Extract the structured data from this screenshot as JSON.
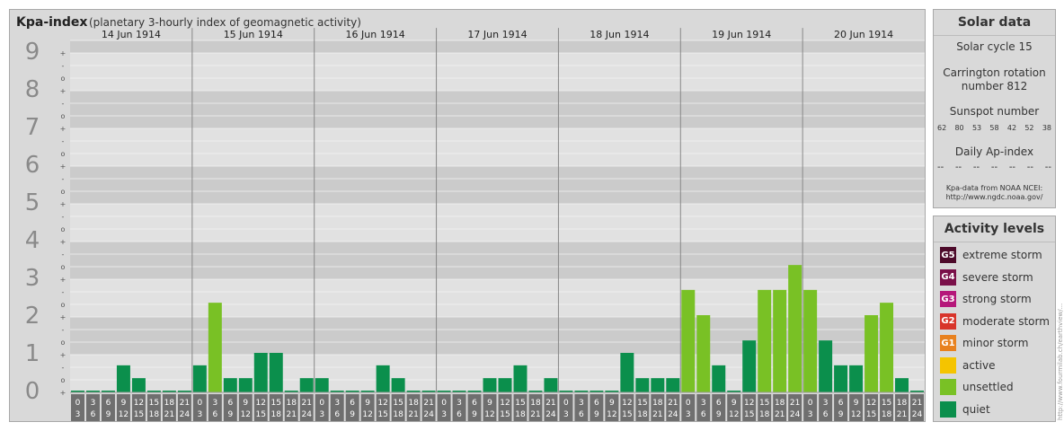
{
  "header": {
    "title": "Kpa-index",
    "subtitle": "(planetary 3-hourly index of geomagnetic activity)"
  },
  "solar_panel": {
    "title": "Solar data",
    "solar_cycle": "Solar cycle 15",
    "carrington_line1": "Carrington rotation",
    "carrington_line2": "number 812",
    "sunspot_title": "Sunspot number",
    "sunspots": [
      "62",
      "80",
      "53",
      "58",
      "42",
      "52",
      "38"
    ],
    "ap_title": "Daily Ap-index",
    "ap_values": [
      "--",
      "--",
      "--",
      "--",
      "--",
      "--",
      "--"
    ],
    "source_line1": "Kpa-data from NOAA NCEI:",
    "source_line2": "http://www.ngdc.noaa.gov/"
  },
  "activity_panel": {
    "title": "Activity levels",
    "levels": [
      {
        "badge": "G5",
        "label": "extreme storm",
        "color": "#4d0a2a"
      },
      {
        "badge": "G4",
        "label": "severe storm",
        "color": "#7a1049"
      },
      {
        "badge": "G3",
        "label": "strong storm",
        "color": "#b5177a"
      },
      {
        "badge": "G2",
        "label": "moderate storm",
        "color": "#d8342a"
      },
      {
        "badge": "G1",
        "label": "minor storm",
        "color": "#e8811e"
      },
      {
        "badge": "",
        "label": "active",
        "color": "#f5c400"
      },
      {
        "badge": "",
        "label": "unsettled",
        "color": "#79c125"
      },
      {
        "badge": "",
        "label": "quiet",
        "color": "#0b8f4c"
      }
    ]
  },
  "watermark": "http://www.fourmilab.ch/earthview/...",
  "chart_data": {
    "type": "bar",
    "title": "Kpa-index",
    "y_axis": {
      "ticks": [
        "0",
        "1",
        "2",
        "3",
        "4",
        "5",
        "6",
        "7",
        "8",
        "9"
      ],
      "min": 0,
      "max": 9.33,
      "thirds_labels": [
        "+",
        "o",
        "-"
      ]
    },
    "days": [
      "14 Jun 1914",
      "15 Jun 1914",
      "16 Jun 1914",
      "17 Jun 1914",
      "18 Jun 1914",
      "19 Jun 1914",
      "20 Jun 1914"
    ],
    "slot_labels_top": [
      "0",
      "3",
      "6",
      "9",
      "12",
      "15",
      "18",
      "21"
    ],
    "slot_labels_bottom": [
      "3",
      "6",
      "9",
      "12",
      "15",
      "18",
      "21",
      "24"
    ],
    "values": [
      [
        0,
        0,
        0,
        0.67,
        0.33,
        0,
        0,
        0
      ],
      [
        0.67,
        2.33,
        0.33,
        0.33,
        1.0,
        1.0,
        0,
        0.33
      ],
      [
        0.33,
        0,
        0,
        0,
        0.67,
        0.33,
        0,
        0
      ],
      [
        0,
        0,
        0,
        0.33,
        0.33,
        0.67,
        0,
        0.33
      ],
      [
        0,
        0,
        0,
        0,
        1.0,
        0.33,
        0.33,
        0.33
      ],
      [
        2.67,
        2.0,
        0.67,
        0,
        1.33,
        2.67,
        2.67,
        3.33
      ],
      [
        2.67,
        1.33,
        0.67,
        0.67,
        2.0,
        2.33,
        0.33,
        0
      ]
    ],
    "colors": {
      "quiet": "#0b8f4c",
      "unsettled": "#79c125"
    },
    "unsettled_threshold": 2
  }
}
